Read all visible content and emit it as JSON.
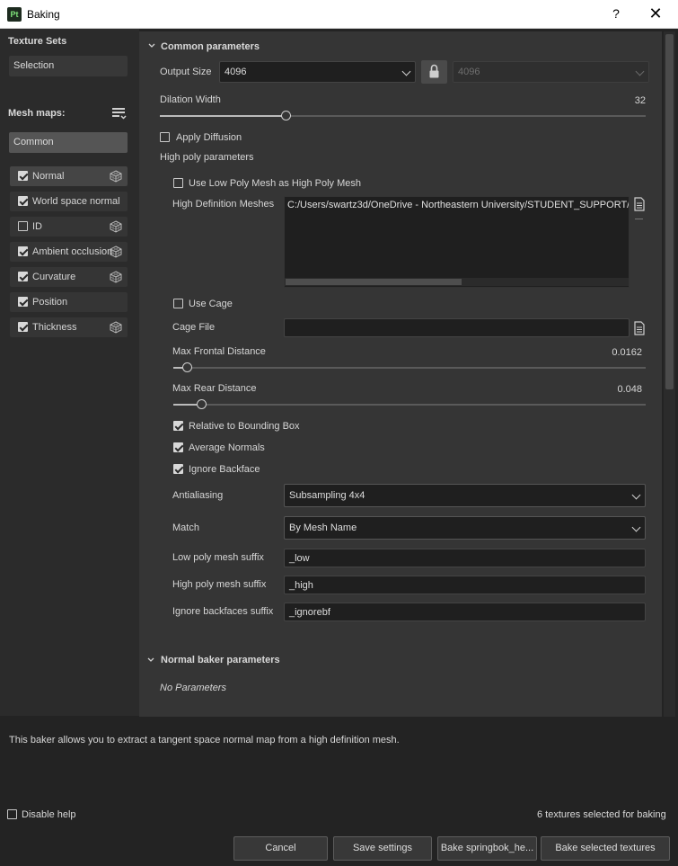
{
  "window": {
    "app_icon": "Pt",
    "title": "Baking",
    "help": "?",
    "close": "✕"
  },
  "left": {
    "texture_sets_title": "Texture Sets",
    "texture_set": "Selection",
    "mesh_maps_title": "Mesh maps:",
    "common_label": "Common",
    "mesh_maps": [
      {
        "label": "Normal",
        "checked": true,
        "has_icon": true
      },
      {
        "label": "World space normal",
        "checked": true,
        "has_icon": false
      },
      {
        "label": "ID",
        "checked": false,
        "has_icon": true
      },
      {
        "label": "Ambient occlusion",
        "checked": true,
        "has_icon": true
      },
      {
        "label": "Curvature",
        "checked": true,
        "has_icon": true
      },
      {
        "label": "Position",
        "checked": true,
        "has_icon": false
      },
      {
        "label": "Thickness",
        "checked": true,
        "has_icon": true
      }
    ]
  },
  "common": {
    "title": "Common parameters",
    "output_size_label": "Output Size",
    "output_size_value": "4096",
    "output_size_locked_value": "4096",
    "dilation_label": "Dilation Width",
    "dilation_value": "32",
    "dilation_fraction": 0.26,
    "apply_diffusion_label": "Apply Diffusion",
    "high_poly_label": "High poly parameters",
    "use_low_as_high_label": "Use Low Poly Mesh as High Poly Mesh",
    "hd_meshes_label": "High Definition Meshes",
    "hd_meshes_value": "C:/Users/swartz3d/OneDrive - Northeastern University/STUDENT_SUPPORT/",
    "use_cage_label": "Use Cage",
    "cage_file_label": "Cage File",
    "cage_file_value": "",
    "max_frontal_label": "Max Frontal Distance",
    "max_frontal_value": "0.0162",
    "max_frontal_fraction": 0.03,
    "max_rear_label": "Max Rear Distance",
    "max_rear_value": "0.048",
    "max_rear_fraction": 0.06,
    "relative_bbox_label": "Relative to Bounding Box",
    "average_normals_label": "Average Normals",
    "ignore_backface_label": "Ignore Backface",
    "antialiasing_label": "Antialiasing",
    "antialiasing_value": "Subsampling 4x4",
    "match_label": "Match",
    "match_value": "By Mesh Name",
    "low_suffix_label": "Low poly mesh suffix",
    "low_suffix_value": "_low",
    "high_suffix_label": "High poly mesh suffix",
    "high_suffix_value": "_high",
    "ignore_bf_suffix_label": "Ignore backfaces suffix",
    "ignore_bf_suffix_value": "_ignorebf"
  },
  "normal_baker": {
    "title": "Normal baker parameters",
    "no_params": "No Parameters"
  },
  "footer": {
    "help_text": "This baker allows you to extract a tangent space normal map from a high definition mesh.",
    "disable_help_label": "Disable help",
    "status": "6 textures selected for baking",
    "cancel": "Cancel",
    "save_settings": "Save settings",
    "bake_single": "Bake springbok_he...",
    "bake_selected": "Bake selected textures"
  }
}
